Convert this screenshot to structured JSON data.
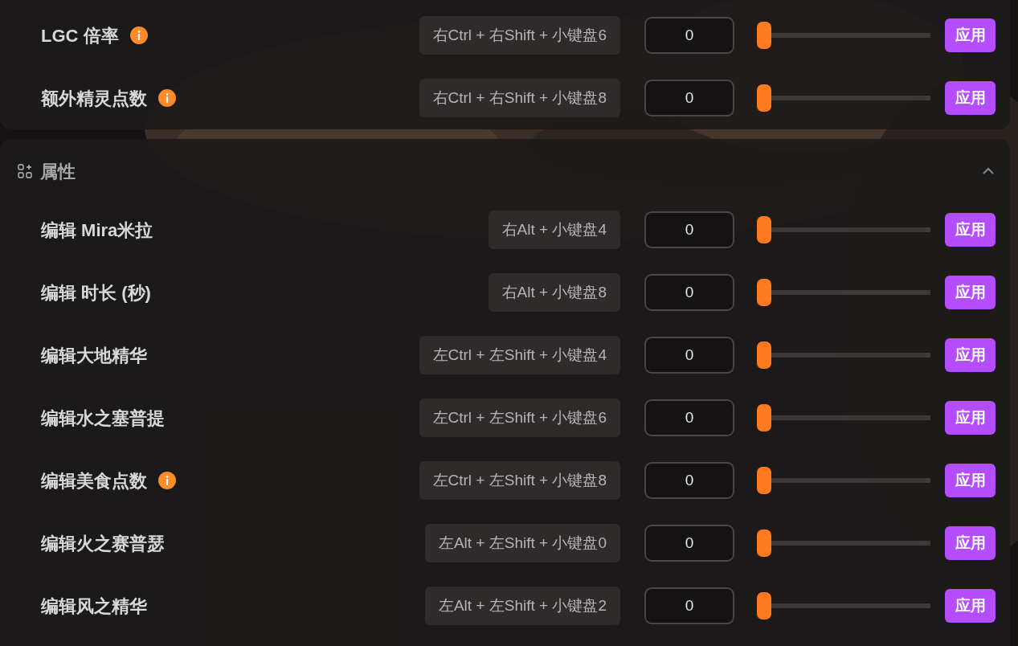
{
  "sections": [
    {
      "rows": [
        {
          "label": "LGC 倍率",
          "info": true,
          "hotkey": "右Ctrl + 右Shift + 小键盘6",
          "value": "0",
          "level": 0,
          "button": "应用"
        },
        {
          "label": "额外精灵点数",
          "info": true,
          "hotkey": "右Ctrl + 右Shift + 小键盘8",
          "value": "0",
          "level": 0,
          "button": "应用"
        }
      ]
    },
    {
      "title": "属性",
      "expanded": true,
      "rows": [
        {
          "label": "编辑 Mira米拉",
          "info": false,
          "hotkey": "右Alt + 小键盘4",
          "value": "0",
          "level": 0,
          "button": "应用"
        },
        {
          "label": "编辑 时长 (秒)",
          "info": false,
          "hotkey": "右Alt + 小键盘8",
          "value": "0",
          "level": 0,
          "button": "应用"
        },
        {
          "label": "编辑大地精华",
          "info": false,
          "hotkey": "左Ctrl + 左Shift + 小键盘4",
          "value": "0",
          "level": 0,
          "button": "应用"
        },
        {
          "label": "编辑水之塞普提",
          "info": false,
          "hotkey": "左Ctrl + 左Shift + 小键盘6",
          "value": "0",
          "level": 0,
          "button": "应用"
        },
        {
          "label": "编辑美食点数",
          "info": true,
          "hotkey": "左Ctrl + 左Shift + 小键盘8",
          "value": "0",
          "level": 0,
          "button": "应用"
        },
        {
          "label": "编辑火之赛普瑟",
          "info": false,
          "hotkey": "左Alt + 左Shift + 小键盘0",
          "value": "0",
          "level": 0,
          "button": "应用"
        },
        {
          "label": "编辑风之精华",
          "info": false,
          "hotkey": "左Alt + 左Shift + 小键盘2",
          "value": "0",
          "level": 0,
          "button": "应用"
        }
      ]
    }
  ]
}
